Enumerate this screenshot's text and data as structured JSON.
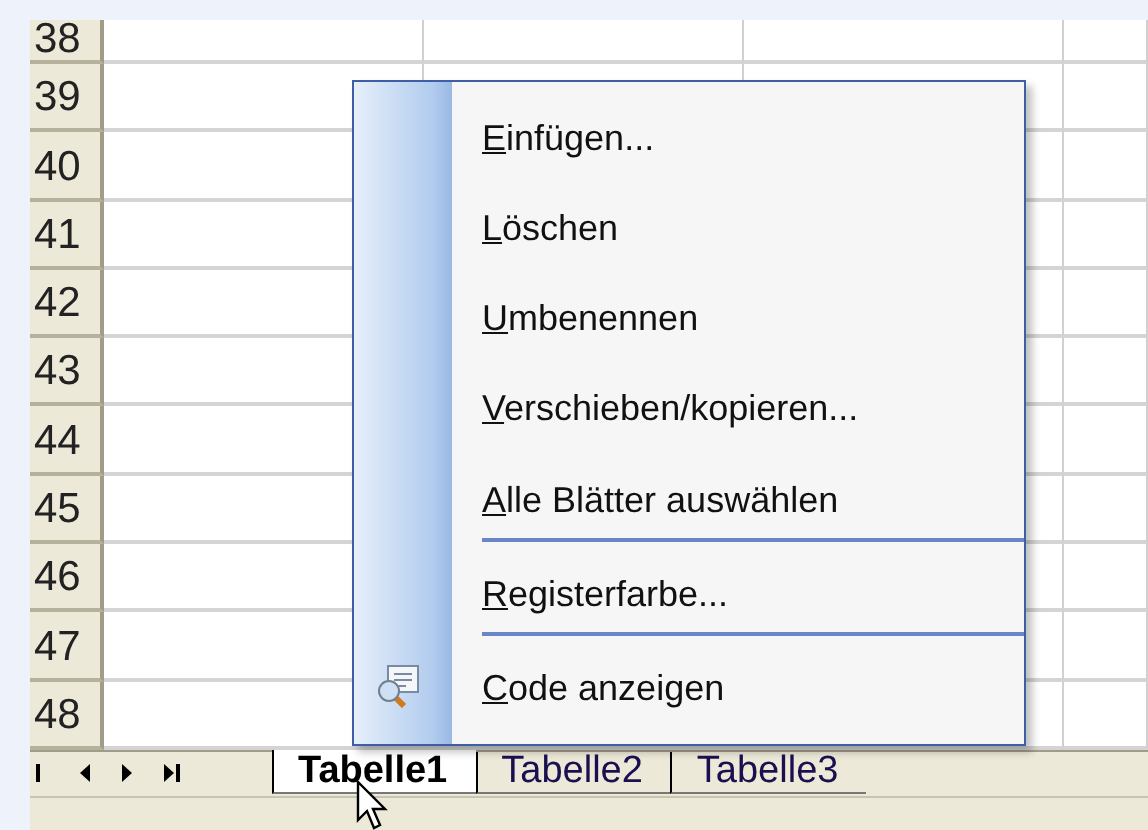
{
  "rows": [
    "38",
    "39",
    "40",
    "41",
    "42",
    "43",
    "44",
    "45",
    "46",
    "47",
    "48"
  ],
  "context_menu": {
    "items": [
      {
        "kind": "item",
        "label": "Einfügen...",
        "mnemonic": true
      },
      {
        "kind": "item",
        "label": "Löschen",
        "mnemonic": true
      },
      {
        "kind": "item",
        "label": "Umbenennen",
        "mnemonic": true
      },
      {
        "kind": "item",
        "label": "Verschieben/kopieren...",
        "mnemonic": true
      },
      {
        "kind": "item",
        "label": "Alle Blätter auswählen",
        "mnemonic": true
      },
      {
        "kind": "separator"
      },
      {
        "kind": "item",
        "label": "Registerfarbe...",
        "mnemonic": true
      },
      {
        "kind": "separator"
      },
      {
        "kind": "icon_item",
        "label": "Code anzeigen",
        "mnemonic": true
      }
    ]
  },
  "sheet_tabs": [
    {
      "label": "Tabelle1",
      "selected": true
    },
    {
      "label": "Tabelle2",
      "selected": false
    },
    {
      "label": "Tabelle3",
      "selected": false
    }
  ]
}
